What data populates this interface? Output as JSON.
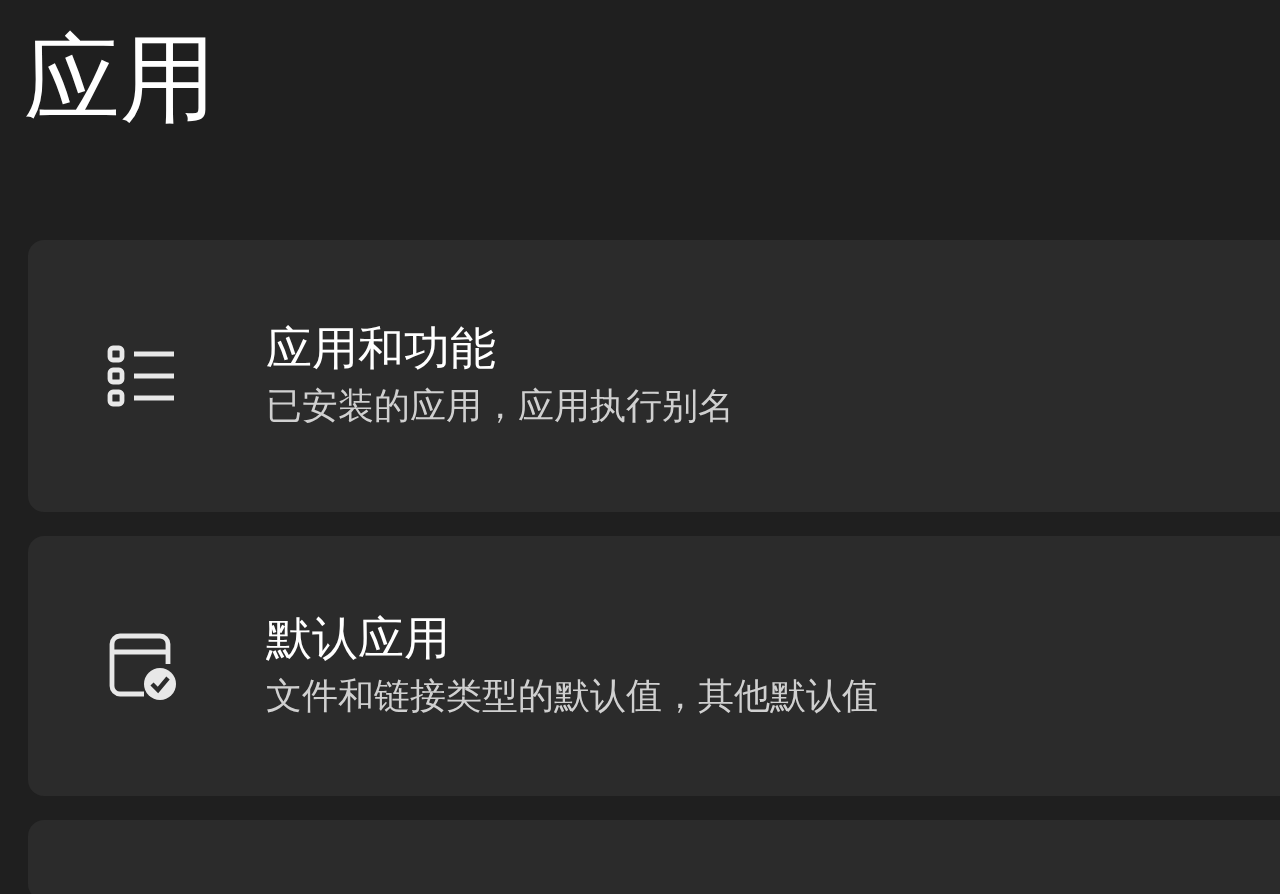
{
  "page_title": "应用",
  "items": [
    {
      "kind": "list",
      "title": "应用和功能",
      "subtitle": "已安装的应用，应用执行别名"
    },
    {
      "kind": "default-app",
      "title": "默认应用",
      "subtitle": "文件和链接类型的默认值，其他默认值"
    }
  ]
}
